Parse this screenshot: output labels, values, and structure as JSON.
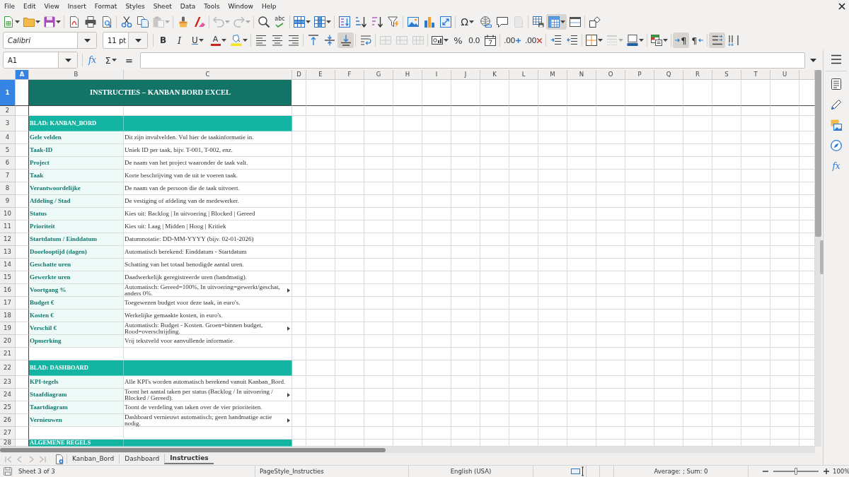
{
  "menu": [
    "File",
    "Edit",
    "View",
    "Insert",
    "Format",
    "Styles",
    "Sheet",
    "Data",
    "Tools",
    "Window",
    "Help"
  ],
  "standard_toolbar": {
    "paste_enabled": false,
    "undo_enabled": false,
    "redo_enabled": false,
    "headers_footers_enabled": false,
    "freeze_rows_columns": true,
    "spelling_label": "abc",
    "special_character_label": "Ω"
  },
  "formatting_toolbar": {
    "font_name": "Calibri",
    "font_size": "11 pt",
    "bold_label": "B",
    "italic_label": "I",
    "underline_label": "U",
    "font_color_label": "A",
    "align_top_pressed": false,
    "align_middle_pressed": false,
    "align_bottom_pressed": true,
    "merge_enabled": false,
    "percent_label": "%",
    "number_label": "0.0",
    "add_decimal_label": ".00",
    "delete_decimal_label": ".00",
    "border_style_enabled": false,
    "ltr_label": "¶",
    "left_to_right_pressed": true,
    "rtl_label": "¶",
    "right_to_left_pressed": false,
    "text_left_to_right_pressed": true,
    "text_top_to_bottom_pressed": false
  },
  "formula_bar": {
    "cell_reference": "A1",
    "function_wizard_label": "fx",
    "sum_label": "Σ",
    "formula_label": "="
  },
  "columns": [
    {
      "label": "A",
      "selected": true
    },
    {
      "label": "B",
      "selected": false
    },
    {
      "label": "C",
      "selected": false
    },
    {
      "label": "D",
      "selected": false
    },
    {
      "label": "E",
      "selected": false
    },
    {
      "label": "F",
      "selected": false
    },
    {
      "label": "G",
      "selected": false
    },
    {
      "label": "H",
      "selected": false
    },
    {
      "label": "I",
      "selected": false
    },
    {
      "label": "J",
      "selected": false
    },
    {
      "label": "K",
      "selected": false
    },
    {
      "label": "L",
      "selected": false
    },
    {
      "label": "M",
      "selected": false
    },
    {
      "label": "N",
      "selected": false
    },
    {
      "label": "O",
      "selected": false
    },
    {
      "label": "P",
      "selected": false
    },
    {
      "label": "Q",
      "selected": false
    },
    {
      "label": "R",
      "selected": false
    },
    {
      "label": "S",
      "selected": false
    },
    {
      "label": "T",
      "selected": false
    },
    {
      "label": "U",
      "selected": false
    }
  ],
  "rows": [
    {
      "number": "1",
      "selected": true,
      "kind": "title",
      "text": "INSTRUCTIES – KANBAN BORD EXCEL"
    },
    {
      "number": "2",
      "selected": false,
      "kind": "blank"
    },
    {
      "number": "3",
      "selected": false,
      "kind": "section",
      "label": "BLAD: KANBAN_BORD"
    },
    {
      "number": "4",
      "selected": false,
      "kind": "field",
      "label": "Gele velden",
      "description": "Dit zijn invulvelden. Vul hier de taakinformatie in.",
      "clipped": false
    },
    {
      "number": "5",
      "selected": false,
      "kind": "field",
      "label": "Taak-ID",
      "description": "Uniek ID per taak, bijv. T-001, T-002, enz.",
      "clipped": false
    },
    {
      "number": "6",
      "selected": false,
      "kind": "field",
      "label": "Project",
      "description": "De naam van het project waaronder de taak valt.",
      "clipped": false
    },
    {
      "number": "7",
      "selected": false,
      "kind": "field",
      "label": "Taak",
      "description": "Korte beschrijving van de uit te voeren taak.",
      "clipped": false
    },
    {
      "number": "8",
      "selected": false,
      "kind": "field",
      "label": "Verantwoordelijke",
      "description": "De naam van de persoon die de taak uitvoert.",
      "clipped": false
    },
    {
      "number": "9",
      "selected": false,
      "kind": "field",
      "label": "Afdeling / Stad",
      "description": "De vestiging of afdeling van de medewerker.",
      "clipped": false
    },
    {
      "number": "10",
      "selected": false,
      "kind": "field",
      "label": "Status",
      "description": "Kies uit: Backlog | In uitvoering | Blocked | Gereed",
      "clipped": false
    },
    {
      "number": "11",
      "selected": false,
      "kind": "field",
      "label": "Prioriteit",
      "description": "Kies uit: Laag | Midden | Hoog | Kritiek",
      "clipped": false
    },
    {
      "number": "12",
      "selected": false,
      "kind": "field",
      "label": "Startdatum / Einddatum",
      "description": "Datumnotatie: DD-MM-YYYY (bijv. 02-01-2026)",
      "clipped": false
    },
    {
      "number": "13",
      "selected": false,
      "kind": "field",
      "label": "Doorlooptijd (dagen)",
      "description": "Automatisch berekend: Einddatum - Startdatum",
      "clipped": false
    },
    {
      "number": "14",
      "selected": false,
      "kind": "field",
      "label": "Geschatte uren",
      "description": "Schatting van het totaal benodigde aantal uren.",
      "clipped": false
    },
    {
      "number": "15",
      "selected": false,
      "kind": "field",
      "label": "Gewerkte uren",
      "description": "Daadwerkelijk geregistreerde uren (handmatig).",
      "clipped": false
    },
    {
      "number": "16",
      "selected": false,
      "kind": "field",
      "label": "Voortgang %",
      "description": "Automatisch: Gereed=100%, In uitvoering=gewerkt/geschat, anders 0%.",
      "clipped": true
    },
    {
      "number": "17",
      "selected": false,
      "kind": "field",
      "label": "Budget €",
      "description": "Toegewezen budget voor deze taak, in euro's.",
      "clipped": false
    },
    {
      "number": "18",
      "selected": false,
      "kind": "field",
      "label": "Kosten €",
      "description": "Werkelijke gemaakte kosten, in euro's.",
      "clipped": false
    },
    {
      "number": "19",
      "selected": false,
      "kind": "field",
      "label": "Verschil €",
      "description": "Automatisch: Budget - Kosten. Groen=binnen budget, Rood=overschrijding.",
      "clipped": true
    },
    {
      "number": "20",
      "selected": false,
      "kind": "field",
      "label": "Opmerking",
      "description": "Vrij tekstveld voor aanvullende informatie.",
      "clipped": false
    },
    {
      "number": "21",
      "selected": false,
      "kind": "blank"
    },
    {
      "number": "22",
      "selected": false,
      "kind": "section",
      "label": "BLAD: DASHBOARD"
    },
    {
      "number": "23",
      "selected": false,
      "kind": "field",
      "label": "KPI-tegels",
      "description": "Alle KPI's worden automatisch berekend vanuit Kanban_Bord.",
      "clipped": false
    },
    {
      "number": "24",
      "selected": false,
      "kind": "field",
      "label": "Staafdiagram",
      "description": "Toont het aantal taken per status (Backlog / In uitvoering / Blocked / Gereed).",
      "clipped": true
    },
    {
      "number": "25",
      "selected": false,
      "kind": "field",
      "label": "Taartdiagram",
      "description": "Toont de verdeling van taken over de vier prioriteiten.",
      "clipped": false
    },
    {
      "number": "26",
      "selected": false,
      "kind": "field",
      "label": "Vernieuwen",
      "description": "Dashboard vernieuwt automatisch; geen handmatige actie nodig.",
      "clipped": true
    },
    {
      "number": "27",
      "selected": false,
      "kind": "blank"
    },
    {
      "number": "28",
      "selected": false,
      "kind": "section",
      "label": "ALGEMENE REGELS"
    }
  ],
  "sheet_tabs": {
    "navigation_enabled": false,
    "tabs": [
      {
        "label": "Kanban_Bord",
        "selected": false
      },
      {
        "label": "Dashboard",
        "selected": false
      },
      {
        "label": "Instructies",
        "selected": true
      }
    ]
  },
  "sidebar": {
    "functions_label": "fx"
  },
  "status_bar": {
    "sheet": "Sheet 3 of 3",
    "page_style": "PageStyle_Instructies",
    "language": "English (USA)",
    "selection_summary": "Average: ; Sum: 0",
    "zoom_slider": {
      "level": 0.5
    },
    "zoom": "100%"
  }
}
